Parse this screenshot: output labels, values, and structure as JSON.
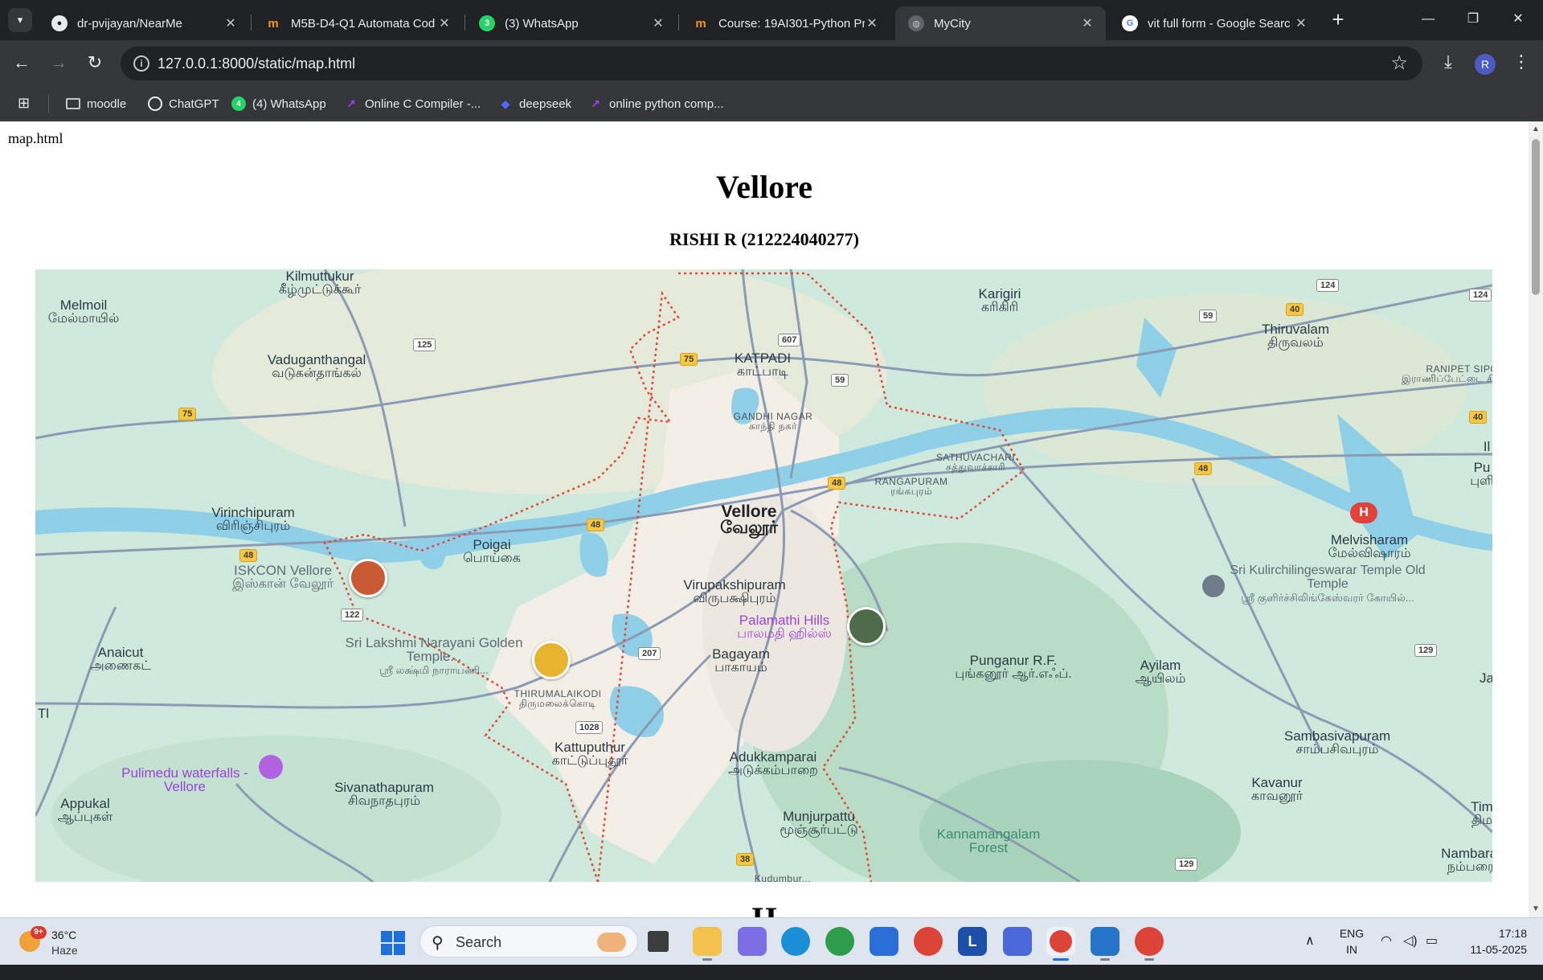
{
  "browser": {
    "tabs": [
      {
        "title": "dr-pvijayan/NearMe",
        "favicon": "github-icon",
        "active": false
      },
      {
        "title": "M5B-D4-Q1 Automata Cod",
        "favicon": "moodle-icon",
        "active": false
      },
      {
        "title": "(3) WhatsApp",
        "favicon": "whatsapp-icon",
        "badge": "3",
        "active": false
      },
      {
        "title": "Course: 19AI301-Python Pr",
        "favicon": "moodle-icon",
        "active": false
      },
      {
        "title": "MyCity",
        "favicon": "globe-icon",
        "active": true
      },
      {
        "title": "vit full form - Google Searc",
        "favicon": "google-icon",
        "active": false
      }
    ],
    "new_tab_label": "+",
    "url": "127.0.0.1:8000/static/map.html",
    "profile_initial": "R",
    "bookmarks": [
      {
        "label": "moodle",
        "icon": "folder-icon"
      },
      {
        "label": "ChatGPT",
        "icon": "chatgpt-icon"
      },
      {
        "label": "(4) WhatsApp",
        "icon": "whatsapp-icon",
        "badge": "4"
      },
      {
        "label": "Online C Compiler -...",
        "icon": "compiler-icon"
      },
      {
        "label": "deepseek",
        "icon": "deepseek-icon"
      },
      {
        "label": "online python comp...",
        "icon": "compiler-icon"
      }
    ]
  },
  "page": {
    "breadcrumb": "map.html",
    "title": "Vellore",
    "subtitle": "RISHI R (212224040277)",
    "next_heading": "H"
  },
  "map": {
    "labels": [
      {
        "en": "Kilmuttukur",
        "ta": "கீழ்முட்டுக்கூர்"
      },
      {
        "en": "Melmoil",
        "ta": "மேல்மாயில்"
      },
      {
        "en": "Vaduganthangal",
        "ta": "வடுகன்தாங்கல்"
      },
      {
        "en": "KATPADI",
        "ta": "காட்பாடி"
      },
      {
        "en": "Karigiri",
        "ta": "கரிகிரி"
      },
      {
        "en": "Thiruvalam",
        "ta": "திருவலம்"
      },
      {
        "en": "RANIPET SIPC",
        "ta": "இராணிப்பேட்டை சிப்காட்"
      },
      {
        "en": "GANDHI NAGAR",
        "ta": "காந்தி நகர்"
      },
      {
        "en": "SATHUVACHARI",
        "ta": "சத்துவாச்சாரி"
      },
      {
        "en": "RANGAPURAM",
        "ta": "ரங்கபுரம்"
      },
      {
        "en": "Virinchipuram",
        "ta": "விரிஞ்சிபுரம்"
      },
      {
        "en": "Vellore",
        "ta": "வேலூர்"
      },
      {
        "en": "Poigai",
        "ta": "பொய்கை"
      },
      {
        "en": "ISKCON Vellore",
        "ta": "இஸ்கான் வேலூர்"
      },
      {
        "en": "Melvisharam",
        "ta": "மேல்விஷாரம்"
      },
      {
        "en": "Sri Kulirchilingeswarar Temple Old Temple",
        "ta": "ஸ்ரீ குளிர்ச்சிலிங்கேஸ்வரர் கோயில்..."
      },
      {
        "en": "Virupakshipuram",
        "ta": "விருபக்ஷிபுரம்"
      },
      {
        "en": "Palamathi Hills",
        "ta": "பாலமதி ஹில்ஸ்"
      },
      {
        "en": "Anaicut",
        "ta": "அணைகட்"
      },
      {
        "en": "Sri Lakshmi Narayani Golden Temple...",
        "ta": "ஸ்ரீ லக்ஷ்மி நாராயணி..."
      },
      {
        "en": "Bagayam",
        "ta": "பாகாயம்"
      },
      {
        "en": "Punganur R.F.",
        "ta": "புங்கனூர் ஆர்.எஃப்."
      },
      {
        "en": "Ayilam",
        "ta": "ஆயிலம்"
      },
      {
        "en": "THIRUMALAIKODI",
        "ta": "திருமலைக்கொடி"
      },
      {
        "en": "Sambasivapuram",
        "ta": "சாம்பசிவபுரம்"
      },
      {
        "en": "Kattuputhur",
        "ta": "காட்டுப்புதூர்"
      },
      {
        "en": "Adukkamparai",
        "ta": "அடுக்கம்பாறை"
      },
      {
        "en": "Pulimedu waterfalls - Vellore",
        "ta": ""
      },
      {
        "en": "Appukal",
        "ta": "ஆப்புகள்"
      },
      {
        "en": "Sivanathapuram",
        "ta": "சிவநாதபுரம்"
      },
      {
        "en": "Kavanur",
        "ta": "காவனூர்"
      },
      {
        "en": "Munjurpattu",
        "ta": "மூஞ்சூர்பட்டு"
      },
      {
        "en": "Kannamangalam Forest",
        "ta": ""
      },
      {
        "en": "Nambarai",
        "ta": "நம்பரை"
      },
      {
        "en": "Tim",
        "ta": "திம"
      },
      {
        "en": "Pu",
        "ta": "புளி"
      },
      {
        "en": "Il",
        "ta": ""
      },
      {
        "en": "Tl",
        "ta": ""
      },
      {
        "en": "Ja",
        "ta": ""
      }
    ],
    "road_shields": [
      "124",
      "124",
      "607",
      "59",
      "40",
      "125",
      "75",
      "75",
      "59",
      "40",
      "48",
      "48",
      "48",
      "48",
      "122",
      "207",
      "1028",
      "129",
      "38",
      "129"
    ],
    "hospital_label": "H",
    "bottom_cut_label": "Kudumbur..."
  },
  "taskbar": {
    "weather_temp": "36°C",
    "weather_cond": "Haze",
    "weather_badge": "9+",
    "search_placeholder": "Search",
    "language": "ENG",
    "region": "IN",
    "time": "17:18",
    "date": "11-05-2025",
    "apps": [
      "task-view-icon",
      "file-explorer-icon",
      "copilot-icon",
      "edge-icon",
      "green-app-icon",
      "store-icon",
      "chrome-icon",
      "l-app-icon",
      "azure-icon",
      "chrome-profile-icon",
      "vscode-icon",
      "chrome-icon"
    ]
  },
  "colors": {
    "chrome_dark": "#202124",
    "chrome_toolbar": "#35363a",
    "map_green": "#cfe9dc",
    "river": "#8fd0e8",
    "boundary": "#e04a3a",
    "road_shield": "#f6c744"
  }
}
